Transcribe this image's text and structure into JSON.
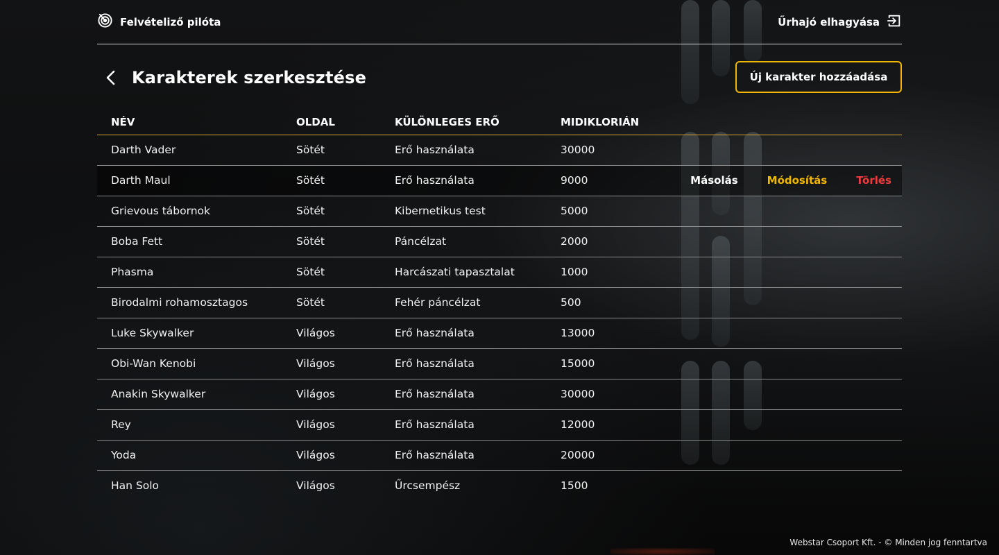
{
  "header": {
    "pilot_label": "Felvételiző pilóta",
    "pilot_icon": "radar-icon",
    "leave_label": "Űrhajó elhagyása",
    "leave_icon": "logout-icon"
  },
  "page": {
    "title": "Karakterek szerkesztése",
    "back_icon": "chevron-left-icon",
    "add_button_label": "Új karakter hozzáadása"
  },
  "table": {
    "columns": [
      "NÉV",
      "OLDAL",
      "KÜLÖNLEGES ERŐ",
      "MIDIKLORIÁN"
    ],
    "rows": [
      {
        "name": "Darth Vader",
        "side": "Sötét",
        "power": "Erő használata",
        "midi": "30000"
      },
      {
        "name": "Darth Maul",
        "side": "Sötét",
        "power": "Erő használata",
        "midi": "9000"
      },
      {
        "name": "Grievous tábornok",
        "side": "Sötét",
        "power": "Kibernetikus test",
        "midi": "5000"
      },
      {
        "name": "Boba Fett",
        "side": "Sötét",
        "power": "Páncélzat",
        "midi": "2000"
      },
      {
        "name": "Phasma",
        "side": "Sötét",
        "power": "Harcászati tapasztalat",
        "midi": "1000"
      },
      {
        "name": "Birodalmi rohamosztagos",
        "side": "Sötét",
        "power": "Fehér páncélzat",
        "midi": "500"
      },
      {
        "name": "Luke Skywalker",
        "side": "Világos",
        "power": "Erő használata",
        "midi": "13000"
      },
      {
        "name": "Obi-Wan Kenobi",
        "side": "Világos",
        "power": "Erő használata",
        "midi": "15000"
      },
      {
        "name": "Anakin Skywalker",
        "side": "Világos",
        "power": "Erő használata",
        "midi": "30000"
      },
      {
        "name": "Rey",
        "side": "Világos",
        "power": "Erő használata",
        "midi": "12000"
      },
      {
        "name": "Yoda",
        "side": "Világos",
        "power": "Erő használata",
        "midi": "20000"
      },
      {
        "name": "Han Solo",
        "side": "Világos",
        "power": "Űrcsempész",
        "midi": "1500"
      }
    ],
    "hovered_row_actions": {
      "copy": "Másolás",
      "modify": "Módosítás",
      "delete": "Törlés"
    }
  },
  "footer": {
    "text": "Webstar Csoport Kft. - © Minden jog fenntartva"
  },
  "colors": {
    "accent": "#f2b705",
    "delete": "#ef3b3b",
    "header_line": "#e0a82e"
  }
}
